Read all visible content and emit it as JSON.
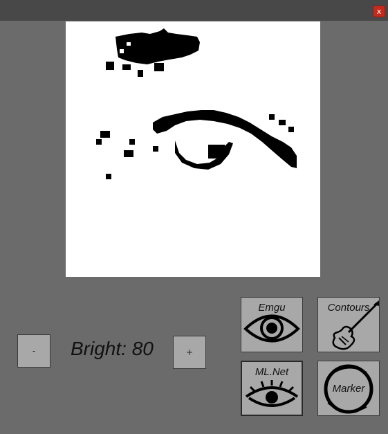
{
  "window": {
    "close_label": "x"
  },
  "brightness": {
    "decrease_label": "-",
    "increase_label": "+",
    "label": "Bright: 80"
  },
  "tools": [
    {
      "label": "Emgu",
      "icon": "eye-icon"
    },
    {
      "label": "Contours",
      "icon": "guitar-icon"
    },
    {
      "label": "ML.Net",
      "icon": "eye-lashes-icon"
    },
    {
      "label": "Marker",
      "icon": "brush-circle-icon"
    }
  ],
  "colors": {
    "background": "#6b6b6b",
    "titlebar": "#484848",
    "close": "#c42b1c",
    "button": "#a8a8a8"
  }
}
